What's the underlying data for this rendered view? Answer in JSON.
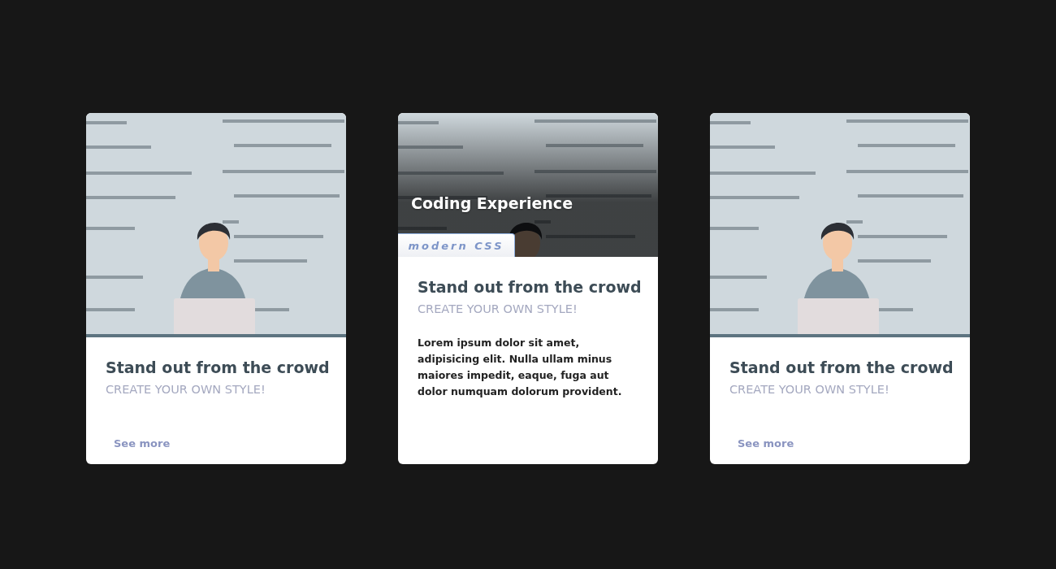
{
  "cards": [
    {
      "expanded": false,
      "title": "Stand out from the crowd",
      "subtitle": "CREATE YOUR OWN STYLE!",
      "link": "See more"
    },
    {
      "expanded": true,
      "caption": "Coding Experience",
      "tag": "modern CSS",
      "title": "Stand out from the crowd",
      "subtitle": "CREATE YOUR OWN STYLE!",
      "description": "Lorem ipsum dolor sit amet, adipisicing elit. Nulla ullam minus maiores impedit, eaque, fuga aut dolor numquam dolorum provident."
    },
    {
      "expanded": false,
      "title": "Stand out from the crowd",
      "subtitle": "CREATE YOUR OWN STYLE!",
      "link": "See more"
    }
  ]
}
